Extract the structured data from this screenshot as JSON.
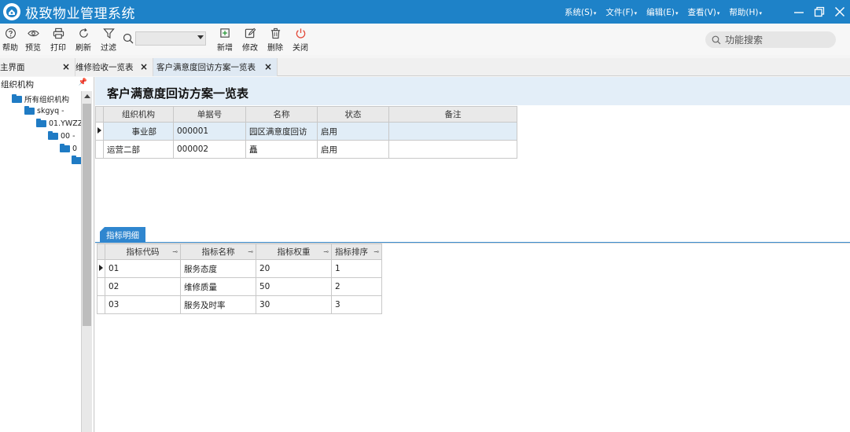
{
  "app": {
    "title": "极致物业管理系统",
    "menus": [
      {
        "label": "系统(S)"
      },
      {
        "label": "文件(F)"
      },
      {
        "label": "编辑(E)"
      },
      {
        "label": "查看(V)"
      },
      {
        "label": "帮助(H)"
      }
    ]
  },
  "toolbar": {
    "help": "帮助",
    "preview": "预览",
    "print": "打印",
    "refresh": "刷新",
    "filter": "过滤",
    "add": "新增",
    "edit": "修改",
    "delete": "删除",
    "close": "关闭",
    "quick_search_value": "",
    "function_search_placeholder": "功能搜索"
  },
  "tabs": [
    {
      "label": "主界面"
    },
    {
      "label": "维修验收一览表"
    },
    {
      "label": "客户满意度回访方案一览表",
      "active": true
    }
  ],
  "tree": {
    "header": "组织机构",
    "nodes": [
      {
        "label": "所有组织机构"
      },
      {
        "label": "skgyq - "
      },
      {
        "label": "01.YWZZ"
      },
      {
        "label": "00 - "
      },
      {
        "label": "0"
      },
      {
        "label": ""
      }
    ]
  },
  "page": {
    "title": "客户满意度回访方案一览表"
  },
  "main_table": {
    "columns": [
      "组织机构",
      "单据号",
      "名称",
      "状态",
      "备注"
    ],
    "rows": [
      {
        "org": "　　　事业部",
        "doc_no": "000001",
        "name": "园区满意度回访",
        "status": "启用",
        "remark": "",
        "selected": true
      },
      {
        "org": "运营二部",
        "doc_no": "000002",
        "name": "矗",
        "status": "启用",
        "remark": ""
      }
    ]
  },
  "detail": {
    "tab_label": "指标明细",
    "columns": [
      "指标代码",
      "指标名称",
      "指标权重",
      "指标排序"
    ],
    "rows": [
      {
        "code": "01",
        "name": "服务态度",
        "weight": "20",
        "order": "1"
      },
      {
        "code": "02",
        "name": "维修质量",
        "weight": "50",
        "order": "2"
      },
      {
        "code": "03",
        "name": "服务及时率",
        "weight": "30",
        "order": "3"
      }
    ]
  },
  "colors": {
    "titlebar": "#1e82c8",
    "accent": "#2f86cf",
    "selected_row": "#e1edf7",
    "header_band": "#e3eef8"
  }
}
